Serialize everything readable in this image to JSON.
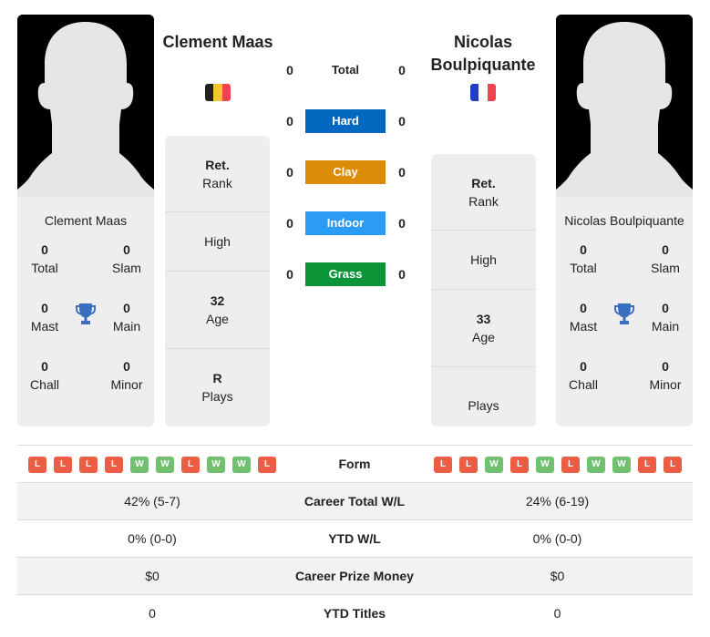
{
  "players": {
    "left": {
      "name": "Clement Maas",
      "card_name": "Clement Maas",
      "country": "Belgium",
      "flag_colors": [
        "#222222",
        "#f7c62f",
        "#f0434f"
      ],
      "titles": {
        "total": {
          "value": "0",
          "label": "Total"
        },
        "slam": {
          "value": "0",
          "label": "Slam"
        },
        "mast": {
          "value": "0",
          "label": "Mast"
        },
        "main": {
          "value": "0",
          "label": "Main"
        },
        "chall": {
          "value": "0",
          "label": "Chall"
        },
        "minor": {
          "value": "0",
          "label": "Minor"
        }
      },
      "info": {
        "rank": {
          "value": "Ret.",
          "label": "Rank"
        },
        "high": {
          "value": "",
          "label": "High"
        },
        "age": {
          "value": "32",
          "label": "Age"
        },
        "plays": {
          "value": "R",
          "label": "Plays"
        }
      },
      "form": [
        "L",
        "L",
        "L",
        "L",
        "W",
        "W",
        "L",
        "W",
        "W",
        "L"
      ]
    },
    "right": {
      "name": "Nicolas Boulpiquante",
      "card_name": "Nicolas Boulpiquante",
      "country": "France",
      "flag_colors": [
        "#1f3fbf",
        "#ffffff",
        "#f0434f"
      ],
      "titles": {
        "total": {
          "value": "0",
          "label": "Total"
        },
        "slam": {
          "value": "0",
          "label": "Slam"
        },
        "mast": {
          "value": "0",
          "label": "Mast"
        },
        "main": {
          "value": "0",
          "label": "Main"
        },
        "chall": {
          "value": "0",
          "label": "Chall"
        },
        "minor": {
          "value": "0",
          "label": "Minor"
        }
      },
      "info": {
        "rank": {
          "value": "Ret.",
          "label": "Rank"
        },
        "high": {
          "value": "",
          "label": "High"
        },
        "age": {
          "value": "33",
          "label": "Age"
        },
        "plays": {
          "value": "",
          "label": "Plays"
        }
      },
      "form": [
        "L",
        "L",
        "W",
        "L",
        "W",
        "L",
        "W",
        "W",
        "L",
        "L"
      ]
    }
  },
  "h2h": [
    {
      "surface": "Total",
      "left": "0",
      "right": "0",
      "color": "transparent"
    },
    {
      "surface": "Hard",
      "left": "0",
      "right": "0",
      "color": "#0468c0"
    },
    {
      "surface": "Clay",
      "left": "0",
      "right": "0",
      "color": "#dd8c08"
    },
    {
      "surface": "Indoor",
      "left": "0",
      "right": "0",
      "color": "#2a9cf5"
    },
    {
      "surface": "Grass",
      "left": "0",
      "right": "0",
      "color": "#0c9438"
    }
  ],
  "stats": {
    "form_label": "Form",
    "rows": [
      {
        "label": "Career Total W/L",
        "left": "42% (5-7)",
        "right": "24% (6-19)"
      },
      {
        "label": "YTD W/L",
        "left": "0% (0-0)",
        "right": "0% (0-0)"
      },
      {
        "label": "Career Prize Money",
        "left": "$0",
        "right": "$0"
      },
      {
        "label": "YTD Titles",
        "left": "0",
        "right": "0"
      }
    ]
  },
  "colors": {
    "win": "#70c070",
    "loss": "#ec5d45",
    "trophy": "#3a6fc0"
  }
}
